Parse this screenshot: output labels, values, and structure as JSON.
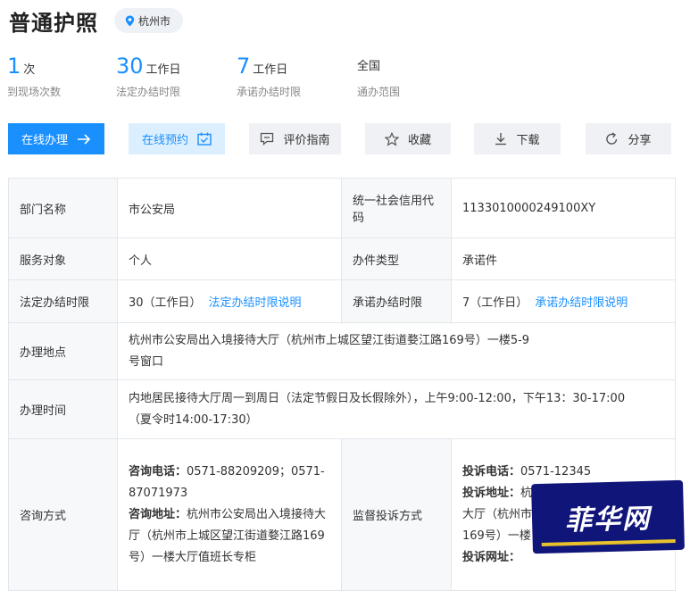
{
  "header": {
    "title": "普通护照",
    "location": "杭州市"
  },
  "stats": [
    {
      "value": "1",
      "unit": "次",
      "label": "到现场次数"
    },
    {
      "value": "30",
      "unit": "工作日",
      "label": "法定办结时限"
    },
    {
      "value": "7",
      "unit": "工作日",
      "label": "承诺办结时限"
    },
    {
      "value": "全国",
      "unit": "",
      "label": "通办范围"
    }
  ],
  "actions": {
    "online_apply": "在线办理",
    "online_booking": "在线预约",
    "rating_guide": "评价指南",
    "favorite": "收藏",
    "download": "下载",
    "share": "分享"
  },
  "info": {
    "dept_label": "部门名称",
    "dept_value": "市公安局",
    "credit_label": "统一社会信用代码",
    "credit_value": "1133010000249100XY",
    "target_label": "服务对象",
    "target_value": "个人",
    "type_label": "办件类型",
    "type_value": "承诺件",
    "legal_limit_label": "法定办结时限",
    "legal_limit_value": "30（工作日）",
    "legal_limit_link": "法定办结时限说明",
    "promise_limit_label": "承诺办结时限",
    "promise_limit_value": "7（工作日）",
    "promise_limit_link": "承诺办结时限说明",
    "address_label": "办理地点",
    "address_value": "杭州市公安局出入境接待大厅（杭州市上城区望江街道婺江路169号）一楼5-9号窗口",
    "hours_label": "办理时间",
    "hours_value": "内地居民接待大厅周一到周日（法定节假日及长假除外），上午9:00-12:00，下午13：30-17:00（夏令时14:00-17:30）",
    "consult_label": "咨询方式",
    "consult_phone_label": "咨询电话：",
    "consult_phone_value": "0571-88209209；0571-87071973",
    "consult_addr_label": "咨询地址：",
    "consult_addr_value": "杭州市公安局出入境接待大厅（杭州市上城区望江街道婺江路169号）一楼大厅值班长专柜",
    "complaint_label": "监督投诉方式",
    "complaint_phone_label": "投诉电话：",
    "complaint_phone_value": "0571-12345",
    "complaint_addr_label": "投诉地址：",
    "complaint_addr_value": "杭",
    "complaint_addr_line2": "大厅（杭州市",
    "complaint_addr_line3": "169号）一楼",
    "complaint_web_label": "投诉网址："
  },
  "watermark": {
    "text": "菲华网"
  },
  "colors": {
    "accent": "#1a90ff",
    "label_bg": "#f7f8fa",
    "border": "#e3e6ea"
  }
}
